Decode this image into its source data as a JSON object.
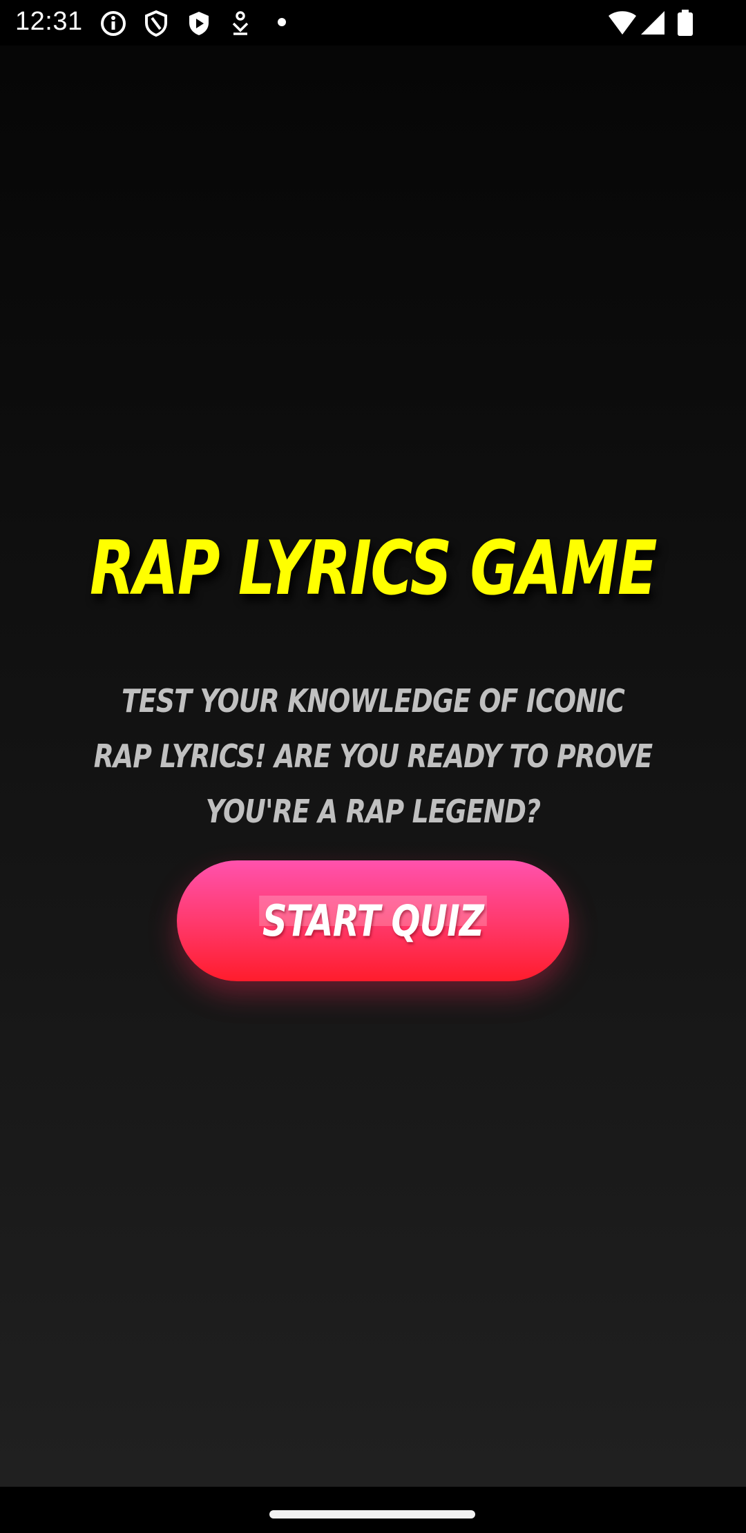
{
  "status_bar": {
    "time": "12:31",
    "left_icons": [
      "info-icon",
      "shield-icon",
      "play-shield-icon",
      "download-icon",
      "dot-icon"
    ],
    "right_icons": [
      "wifi-icon",
      "signal-icon",
      "battery-icon"
    ]
  },
  "main": {
    "title": "RAP LYRICS GAME",
    "subtitle": "TEST YOUR KNOWLEDGE OF ICONIC RAP LYRICS! ARE YOU READY TO PROVE YOU'RE A RAP LEGEND?",
    "start_button_label": "START QUIZ"
  },
  "colors": {
    "title": "#ffff00",
    "subtitle": "#c0c0c0",
    "button_top": "#ff52ad",
    "button_bottom": "#ff1c2c",
    "background_top": "#050505",
    "background_bottom": "#212121"
  }
}
